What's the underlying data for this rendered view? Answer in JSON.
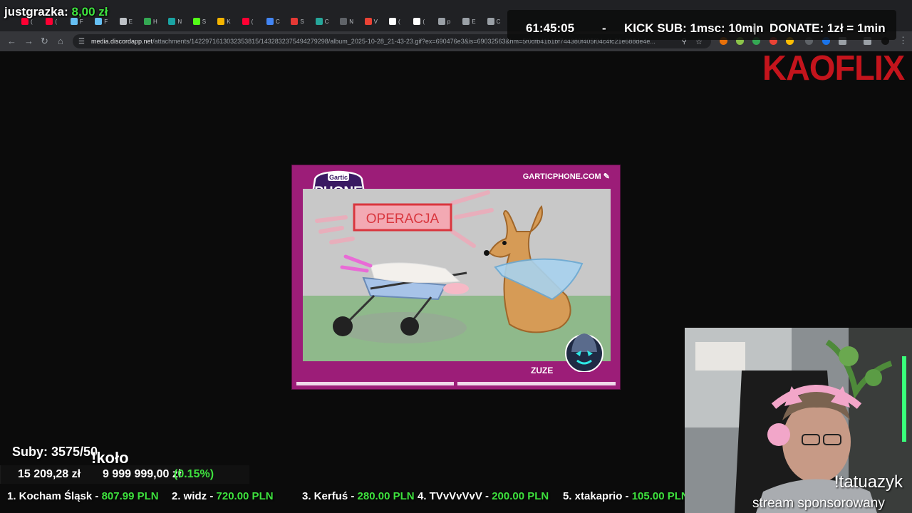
{
  "browser": {
    "tabs": [
      {
        "label": "(",
        "icon": "youtube-icon",
        "color": "#ff0033"
      },
      {
        "label": "(",
        "icon": "youtube-icon",
        "color": "#ff0033"
      },
      {
        "label": "F",
        "icon": "steam-icon",
        "color": "#66c0f4"
      },
      {
        "label": "F",
        "icon": "steam-icon",
        "color": "#66c0f4"
      },
      {
        "label": "E",
        "icon": "doc-icon",
        "color": "#bdc1c6"
      },
      {
        "label": "H",
        "icon": "drive-icon",
        "color": "#34a853"
      },
      {
        "label": "N",
        "icon": "p-icon",
        "color": "#1aa3a3"
      },
      {
        "label": "S",
        "icon": "kick-icon",
        "color": "#53fc18"
      },
      {
        "label": "K",
        "icon": "calendar-icon",
        "color": "#f4b400"
      },
      {
        "label": "(",
        "icon": "youtube-icon",
        "color": "#ff0033"
      },
      {
        "label": "C",
        "icon": "google-icon",
        "color": "#4285f4"
      },
      {
        "label": "S",
        "icon": "flag-icon",
        "color": "#e53935"
      },
      {
        "label": "C",
        "icon": "translate-icon",
        "color": "#26a69a"
      },
      {
        "label": "N",
        "icon": "blank-icon",
        "color": "#5f6368"
      },
      {
        "label": "V",
        "icon": "record-icon",
        "color": "#ea4335"
      },
      {
        "label": "(",
        "icon": "tiktok-icon",
        "color": "#ffffff"
      },
      {
        "label": "(",
        "icon": "tiktok-icon",
        "color": "#ffffff"
      },
      {
        "label": "p",
        "icon": "globe-icon",
        "color": "#9aa0a6"
      },
      {
        "label": "E",
        "icon": "globe-icon",
        "color": "#9aa0a6"
      },
      {
        "label": "C",
        "icon": "globe-icon",
        "color": "#9aa0a6"
      }
    ],
    "url_host": "media.discordapp.net",
    "url_path": "/attachments/1422971613032353815/1432832375494279298/album_2025-10-28_21-43-23.gif?ex=690476e3&is=69032563&hm=5f0dfb41b1bf744380f405f04c4fc21e688de4e..."
  },
  "overlay": {
    "donor_name": "justgrazka:",
    "donor_amount": "8,00 zł",
    "timer": "61:45:05",
    "sep1": "-",
    "kick_sub": "KICK SUB: 1msc: 10min",
    "sep2": "|",
    "donate": "DONATE: 1zł = 1min",
    "brand": "KAOFLIX"
  },
  "gartic": {
    "logo_top": "Gartic",
    "logo_main": "PHONE",
    "site": "GARTICPHONE.COM",
    "drawing_text": "OPERACJA",
    "author": "ZUZE",
    "progress": 0.5
  },
  "stats": {
    "subs": "Suby: 3575/50",
    "command": "!koło",
    "goal_current": "15 209,28 zł",
    "goal_target": "9 999 999,00 zł",
    "goal_percent": "(0.15%)",
    "goal_fraction": 0.0015
  },
  "ticker": [
    {
      "name": "1. Kocham Śląsk - ",
      "value": "807.99 PLN"
    },
    {
      "name": "2. widz - ",
      "value": "720.00 PLN"
    },
    {
      "name": "3. Kerfuś - ",
      "value": "280.00 PLN"
    },
    {
      "name": "4. TVvVvVvV - ",
      "value": "200.00 PLN"
    },
    {
      "name": "5. xtakaprio - ",
      "value": "105.00 PLN"
    }
  ],
  "webcam": {
    "command": "!tatuazyk",
    "caption": "stream sponsorowany"
  }
}
